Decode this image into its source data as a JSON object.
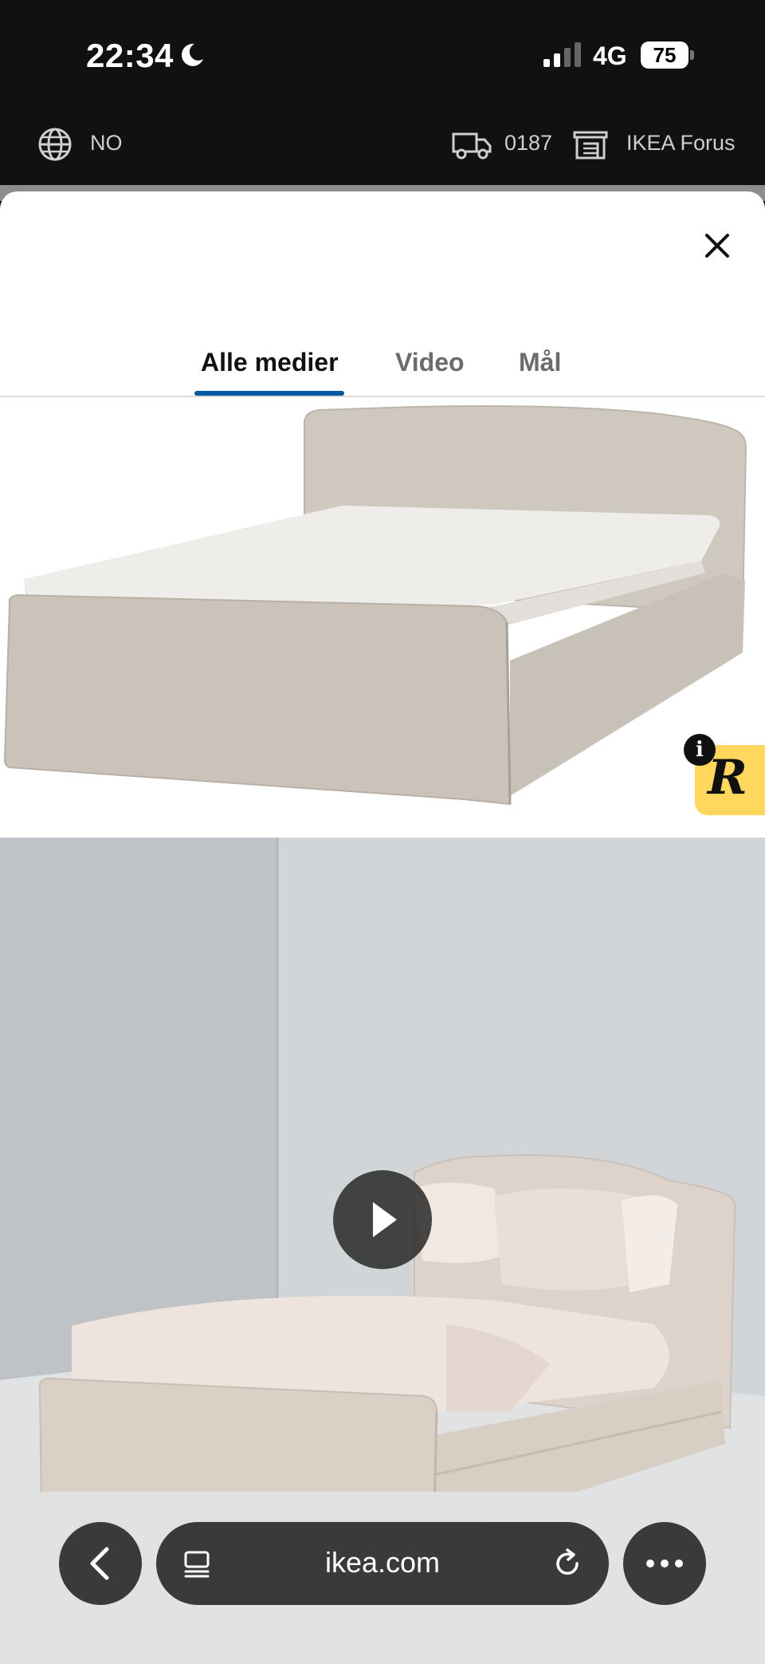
{
  "status_bar": {
    "time": "22:34",
    "network": "4G",
    "battery": "75"
  },
  "ikea_bar": {
    "region": "NO",
    "postcode": "0187",
    "store": "IKEA Forus"
  },
  "tabs": [
    {
      "label": "Alle medier",
      "active": true
    },
    {
      "label": "Video",
      "active": false
    },
    {
      "label": "Mål",
      "active": false
    }
  ],
  "overlay_badge": {
    "letter": "R",
    "info": "i"
  },
  "browser": {
    "url": "ikea.com"
  },
  "icons": [
    "moon-icon",
    "signal-icon",
    "globe-icon",
    "truck-icon",
    "store-icon",
    "close-icon",
    "play-icon",
    "back-icon",
    "reader-icon",
    "reload-icon",
    "more-icon"
  ]
}
